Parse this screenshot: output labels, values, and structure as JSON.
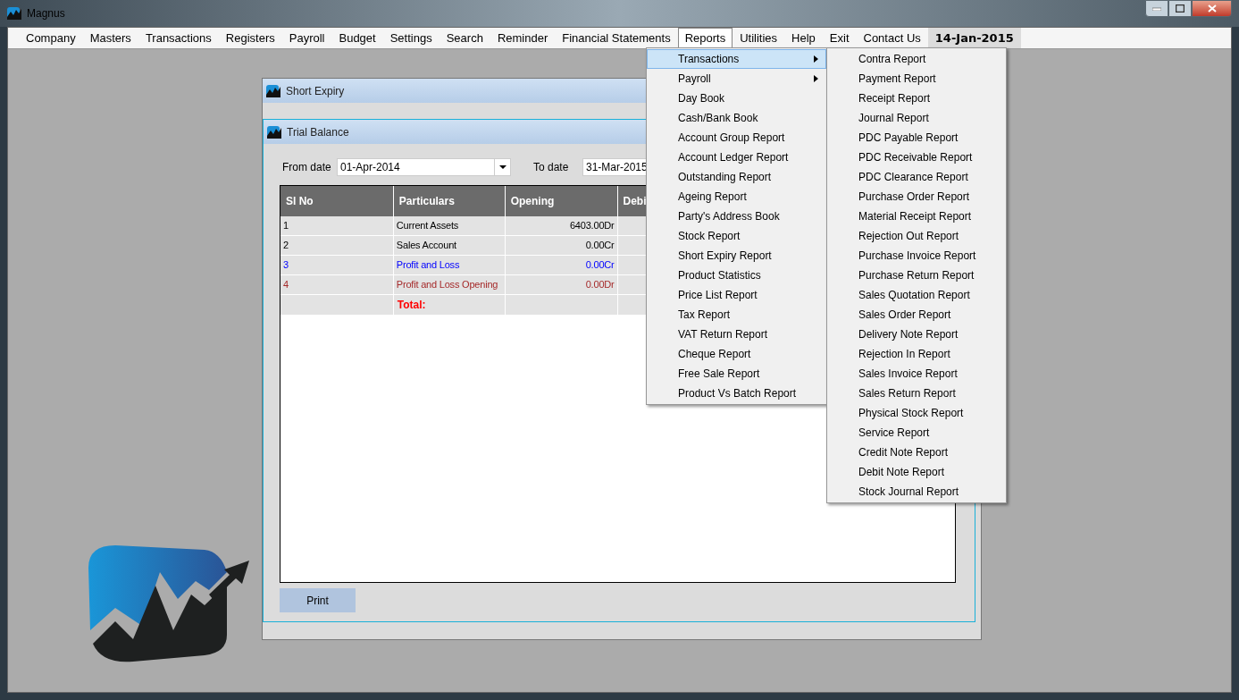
{
  "window": {
    "title": "Magnus"
  },
  "menubar": [
    {
      "label": "Company",
      "kind": "menu",
      "selected": false
    },
    {
      "label": "Masters",
      "kind": "menu",
      "selected": false
    },
    {
      "label": "Transactions",
      "kind": "menu",
      "selected": false
    },
    {
      "label": "Registers",
      "kind": "menu",
      "selected": false
    },
    {
      "label": "Payroll",
      "kind": "menu",
      "selected": false
    },
    {
      "label": "Budget",
      "kind": "menu",
      "selected": false
    },
    {
      "label": "Settings",
      "kind": "menu",
      "selected": false
    },
    {
      "label": "Search",
      "kind": "menu",
      "selected": false
    },
    {
      "label": "Reminder",
      "kind": "menu",
      "selected": false
    },
    {
      "label": "Financial Statements",
      "kind": "menu",
      "selected": false
    },
    {
      "label": "Reports",
      "kind": "menu",
      "selected": true
    },
    {
      "label": "Utilities",
      "kind": "menu",
      "selected": false
    },
    {
      "label": "Help",
      "kind": "menu",
      "selected": false
    },
    {
      "label": "Exit",
      "kind": "menu",
      "selected": false
    },
    {
      "label": "Contact Us",
      "kind": "menu",
      "selected": false
    },
    {
      "label": "14-Jan-2015",
      "kind": "date"
    }
  ],
  "short_expiry_window": {
    "title": "Short Expiry"
  },
  "trial_balance_window": {
    "title": "Trial Balance",
    "from_date": {
      "label": "From date",
      "value": "01-Apr-2014"
    },
    "to_date": {
      "label": "To date",
      "value": "31-Mar-2015"
    },
    "table": {
      "columns": [
        "Sl No",
        "Particulars",
        "Opening",
        "Debi"
      ],
      "rows": [
        {
          "cells": [
            "1",
            "Current Assets",
            "6403.00Dr"
          ],
          "color": "#000000"
        },
        {
          "cells": [
            "2",
            "Sales Account",
            "0.00Cr"
          ],
          "color": "#000000"
        },
        {
          "cells": [
            "3",
            "Profit and Loss",
            "0.00Cr"
          ],
          "color": "#0000ff"
        },
        {
          "cells": [
            "4",
            "Profit and Loss Opening",
            "0.00Dr"
          ],
          "color": "#a52a2a"
        }
      ],
      "total": {
        "label": "Total:"
      }
    },
    "print_button": "Print"
  },
  "reports_menu": [
    {
      "label": "Transactions",
      "has_submenu": true,
      "selected": true
    },
    {
      "label": "Payroll",
      "has_submenu": true,
      "selected": false
    },
    {
      "label": "Day Book",
      "has_submenu": false,
      "selected": false
    },
    {
      "label": "Cash/Bank Book",
      "has_submenu": false,
      "selected": false
    },
    {
      "label": "Account Group Report",
      "has_submenu": false,
      "selected": false
    },
    {
      "label": "Account Ledger Report",
      "has_submenu": false,
      "selected": false
    },
    {
      "label": "Outstanding Report",
      "has_submenu": false,
      "selected": false
    },
    {
      "label": "Ageing Report",
      "has_submenu": false,
      "selected": false
    },
    {
      "label": "Party's Address Book",
      "has_submenu": false,
      "selected": false
    },
    {
      "label": "Stock Report",
      "has_submenu": false,
      "selected": false
    },
    {
      "label": "Short Expiry Report",
      "has_submenu": false,
      "selected": false
    },
    {
      "label": "Product Statistics",
      "has_submenu": false,
      "selected": false
    },
    {
      "label": "Price List Report",
      "has_submenu": false,
      "selected": false
    },
    {
      "label": "Tax Report",
      "has_submenu": false,
      "selected": false
    },
    {
      "label": "VAT Return Report",
      "has_submenu": false,
      "selected": false
    },
    {
      "label": "Cheque Report",
      "has_submenu": false,
      "selected": false
    },
    {
      "label": "Free Sale Report",
      "has_submenu": false,
      "selected": false
    },
    {
      "label": "Product Vs Batch Report",
      "has_submenu": false,
      "selected": false
    }
  ],
  "transactions_submenu": [
    "Contra Report",
    "Payment Report",
    "Receipt Report",
    "Journal Report",
    "PDC Payable Report",
    "PDC Receivable Report",
    "PDC Clearance Report",
    "Purchase Order Report",
    "Material Receipt Report",
    "Rejection Out Report",
    "Purchase Invoice Report",
    "Purchase Return Report",
    "Sales Quotation Report",
    "Sales Order Report",
    "Delivery Note Report",
    "Rejection In Report",
    "Sales Invoice Report",
    "Sales Return Report",
    "Physical Stock Report",
    "Service Report",
    "Credit Note Report",
    "Debit Note Report",
    "Stock Journal Report"
  ]
}
